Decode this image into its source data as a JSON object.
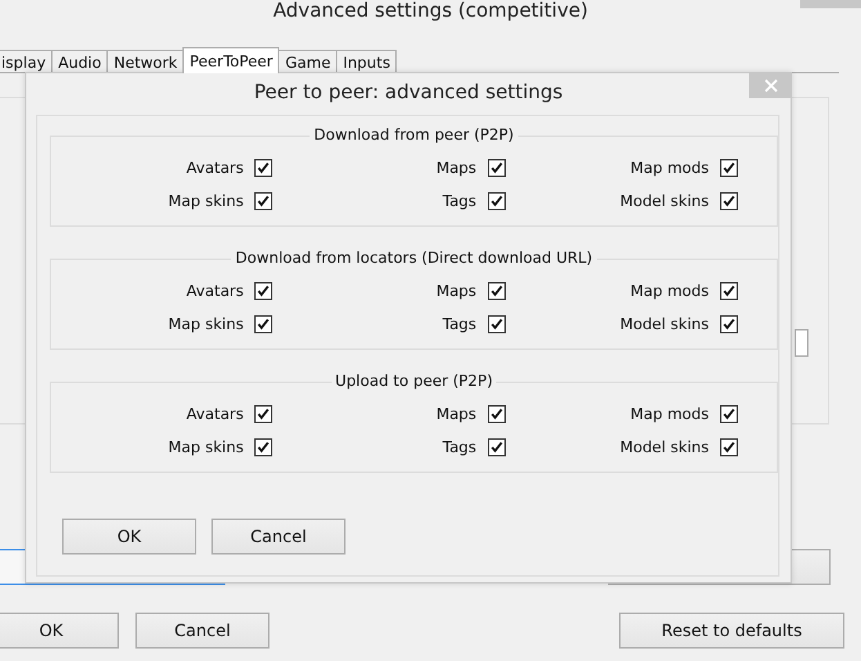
{
  "background_window": {
    "title": "Advanced settings (competitive)",
    "tabs": [
      {
        "label": "isplay",
        "selected": false
      },
      {
        "label": "Audio",
        "selected": false
      },
      {
        "label": "Network",
        "selected": false
      },
      {
        "label": "PeerToPeer",
        "selected": true
      },
      {
        "label": "Game",
        "selected": false
      },
      {
        "label": "Inputs",
        "selected": false
      }
    ],
    "buttons": [
      {
        "label": "OK"
      },
      {
        "label": "Cancel"
      },
      {
        "label": "Reset to defaults"
      }
    ]
  },
  "dialog": {
    "title": "Peer to peer: advanced settings",
    "groups": [
      {
        "title": "Download from peer (P2P)",
        "options": [
          {
            "label": "Avatars",
            "checked": true
          },
          {
            "label": "Maps",
            "checked": true
          },
          {
            "label": "Map mods",
            "checked": true
          },
          {
            "label": "Map skins",
            "checked": true
          },
          {
            "label": "Tags",
            "checked": true
          },
          {
            "label": "Model skins",
            "checked": true
          }
        ]
      },
      {
        "title": "Download from locators (Direct download URL)",
        "options": [
          {
            "label": "Avatars",
            "checked": true
          },
          {
            "label": "Maps",
            "checked": true
          },
          {
            "label": "Map mods",
            "checked": true
          },
          {
            "label": "Map skins",
            "checked": true
          },
          {
            "label": "Tags",
            "checked": true
          },
          {
            "label": "Model skins",
            "checked": true
          }
        ]
      },
      {
        "title": "Upload to peer (P2P)",
        "options": [
          {
            "label": "Avatars",
            "checked": true
          },
          {
            "label": "Maps",
            "checked": true
          },
          {
            "label": "Map mods",
            "checked": true
          },
          {
            "label": "Map skins",
            "checked": true
          },
          {
            "label": "Tags",
            "checked": true
          },
          {
            "label": "Model skins",
            "checked": true
          }
        ]
      }
    ],
    "buttons": [
      {
        "label": "OK"
      },
      {
        "label": "Cancel"
      }
    ]
  }
}
